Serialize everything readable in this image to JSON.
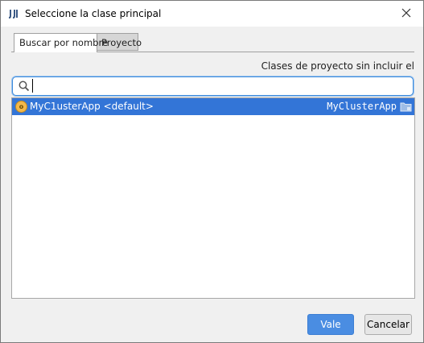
{
  "window": {
    "title": "Seleccione la clase principal",
    "app_icon": "intellij-icon",
    "close_glyph": "✕"
  },
  "tabs": [
    {
      "label": "Buscar por nombre",
      "active": true
    },
    {
      "label": "Proyecto",
      "active": false
    }
  ],
  "hint": "Clases de proyecto sin incluir el",
  "search": {
    "value": "",
    "placeholder": "",
    "icon": "search-icon"
  },
  "results": [
    {
      "icon": "class-icon",
      "icon_glyph": "o",
      "name": "MyC1usterApp <default>",
      "module": "MyClusterApp",
      "module_icon": "folder-icon",
      "selected": true
    }
  ],
  "buttons": {
    "ok": "Vale",
    "cancel": "Cancelar"
  },
  "colors": {
    "accent": "#3375d7",
    "primary_button": "#4a8de2",
    "search_border": "#3d8bdc",
    "class_icon": "#f2b84b"
  }
}
